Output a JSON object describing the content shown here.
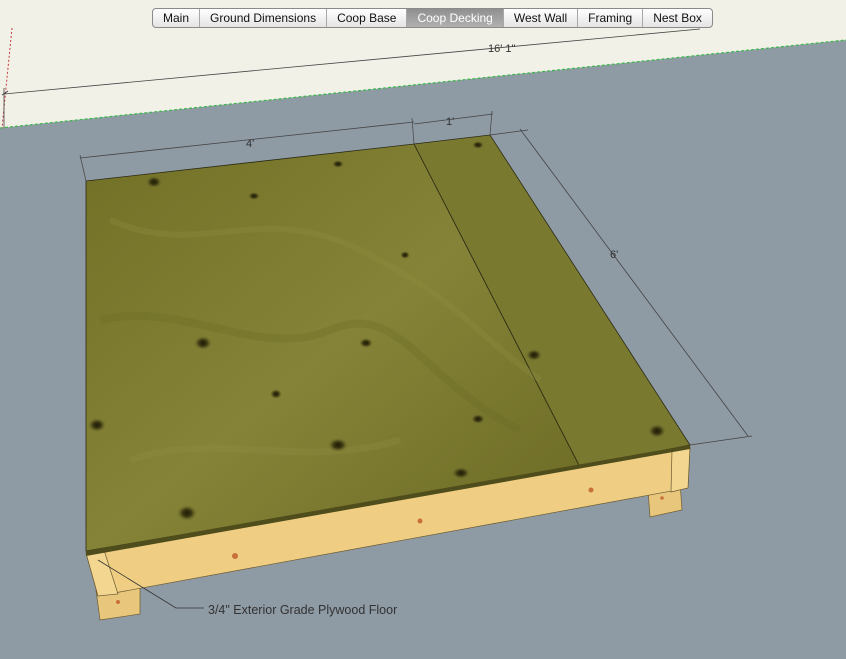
{
  "scene_tabs": [
    {
      "label": "Main",
      "active": false
    },
    {
      "label": "Ground Dimensions",
      "active": false
    },
    {
      "label": "Coop Base",
      "active": false
    },
    {
      "label": "Coop Decking",
      "active": true
    },
    {
      "label": "West Wall",
      "active": false
    },
    {
      "label": "Framing",
      "active": false
    },
    {
      "label": "Nest Box",
      "active": false
    }
  ],
  "dimensions": {
    "overall_length": "16' 1\"",
    "sheet_width": "4'",
    "strip_width": "1'",
    "depth": "6'"
  },
  "annotation": {
    "label": "3/4\" Exterior Grade Plywood Floor"
  },
  "colors": {
    "background": "#8e9aa4",
    "ground_plane": "#f2f1e8",
    "plywood": "#7e7d35",
    "lumber": "#efce84",
    "active_tab": "#9c9c9c"
  }
}
